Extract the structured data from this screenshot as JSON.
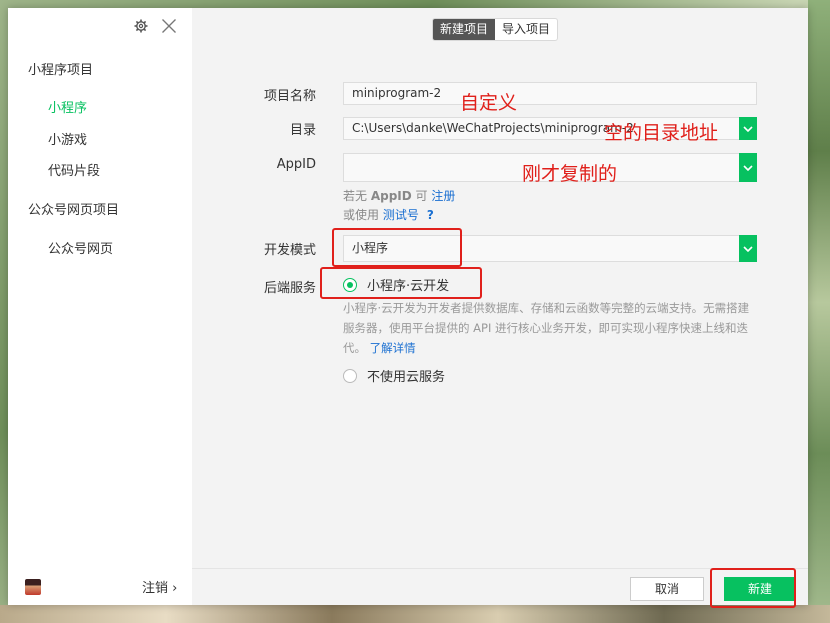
{
  "sidebar": {
    "section_miniprogram": "小程序项目",
    "items_mini": [
      {
        "label": "小程序",
        "active": true
      },
      {
        "label": "小游戏"
      },
      {
        "label": "代码片段"
      }
    ],
    "section_official": "公众号网页项目",
    "items_official": [
      {
        "label": "公众号网页"
      }
    ],
    "logout_label": "注销 ›"
  },
  "tabs": [
    {
      "label": "新建项目",
      "active": true
    },
    {
      "label": "导入项目"
    }
  ],
  "form": {
    "project_name_label": "项目名称",
    "project_name_value": "miniprogram-2",
    "directory_label": "目录",
    "directory_value": "C:\\Users\\danke\\WeChatProjects\\miniprogram-2",
    "appid_label": "AppID",
    "appid_value": "",
    "appid_hint_prefix": "若无 ",
    "appid_hint_bold": "AppID",
    "appid_hint_mid": " 可 ",
    "appid_hint_register": "注册",
    "appid_hint2_prefix": "或使用 ",
    "appid_hint2_test": "测试号",
    "appid_hint2_q": "?",
    "dev_mode_label": "开发模式",
    "dev_mode_value": "小程序",
    "backend_label": "后端服务",
    "option_cloud": "小程序·云开发",
    "cloud_desc": "小程序·云开发为开发者提供数据库、存储和云函数等完整的云端支持。无需搭建服务器，使用平台提供的 API 进行核心业务开发，即可实现小程序快速上线和迭代。",
    "cloud_desc_link": "了解详情",
    "option_none": "不使用云服务"
  },
  "annotations": {
    "custom": "自定义",
    "empty_dir": "空的目录地址",
    "just_copied": "刚才复制的"
  },
  "buttons": {
    "cancel": "取消",
    "create": "新建"
  },
  "colors": {
    "accent": "#07c160",
    "annotation": "#e0201b",
    "link": "#1a6fd1"
  }
}
